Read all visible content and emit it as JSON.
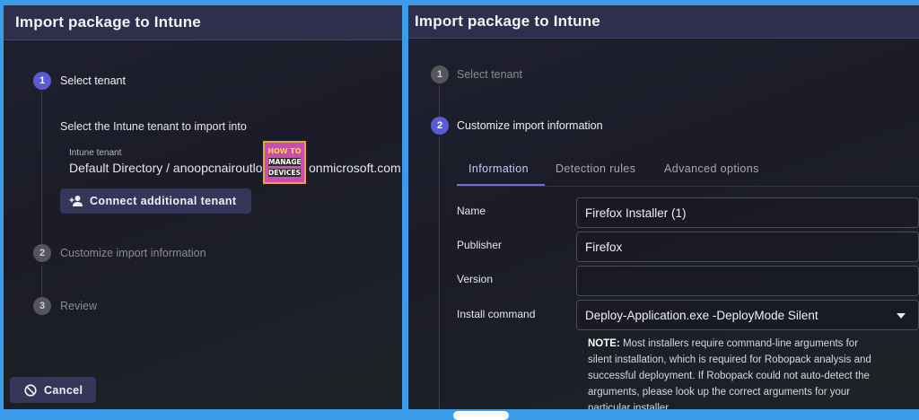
{
  "left": {
    "title": "Import package to Intune",
    "steps": [
      {
        "num": "1",
        "label": "Select tenant"
      },
      {
        "num": "2",
        "label": "Customize import information"
      },
      {
        "num": "3",
        "label": "Review"
      }
    ],
    "instruction": "Select the Intune tenant to import into",
    "tenant_field": {
      "label": "Intune tenant",
      "value_before": "Default Directory / anoopcnairoutlo",
      "value_after": "onmicrosoft.com"
    },
    "connect_button": "Connect additional tenant",
    "cancel_button": "Cancel"
  },
  "watermark": {
    "line1": "HOW TO",
    "line2": "MANAGE",
    "line3": "DEVICES"
  },
  "right": {
    "title": "Import package to Intune",
    "steps": [
      {
        "num": "1",
        "label": "Select tenant"
      },
      {
        "num": "2",
        "label": "Customize import information"
      }
    ],
    "tabs": [
      "Information",
      "Detection rules",
      "Advanced options"
    ],
    "active_tab": "Information",
    "fields": [
      {
        "label": "Name",
        "value": "Firefox Installer (1)"
      },
      {
        "label": "Publisher",
        "value": "Firefox"
      },
      {
        "label": "Version",
        "value": ""
      },
      {
        "label": "Install command",
        "value": "Deploy-Application.exe -DeployMode Silent"
      }
    ],
    "note_prefix": "NOTE:",
    "note_text": "Most installers require command-line arguments for silent installation, which is required for Robopack analysis and successful deployment. If Robopack could not auto-detect the arguments, please look up the correct arguments for your particular installer."
  },
  "colors": {
    "accent": "#5b5bd6",
    "titlebar": "#2e2f4d",
    "frame": "#3a9bea"
  }
}
